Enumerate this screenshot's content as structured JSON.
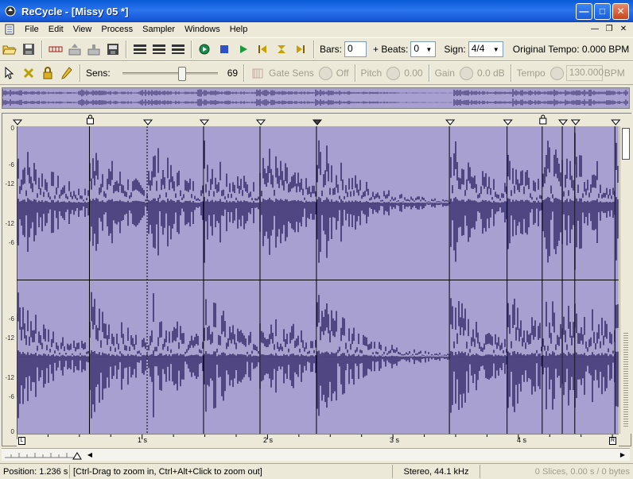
{
  "window": {
    "title": "ReCycle - [Missy 05 *]"
  },
  "menu": [
    "File",
    "Edit",
    "View",
    "Process",
    "Sampler",
    "Windows",
    "Help"
  ],
  "toolbar1": {
    "bars_label": "Bars:",
    "bars_value": "0",
    "beats_label": "+ Beats:",
    "beats_value": "0",
    "sign_label": "Sign:",
    "sign_value": "4/4",
    "original_tempo": "Original Tempo:  0.000 BPM"
  },
  "toolbar2": {
    "sens_label": "Sens:",
    "sens_value": "69",
    "gate_label": "Gate Sens",
    "gate_value": "Off",
    "pitch_label": "Pitch",
    "pitch_value": "0.00",
    "gain_label": "Gain",
    "gain_value": "0.0 dB",
    "tempo_label": "Tempo",
    "tempo_value": "130.000",
    "tempo_unit": "BPM"
  },
  "waveform": {
    "db_ticks": [
      "0",
      "-6",
      "-12",
      "-12",
      "-6",
      "-6",
      "-12",
      "-12",
      "-6",
      "0"
    ],
    "time_labels": [
      "1 s",
      "2 s",
      "3 s",
      "4 s"
    ],
    "marker_L": "L",
    "marker_R": "R",
    "slice_points_sec": [
      0.0,
      0.58,
      1.04,
      1.49,
      1.94,
      2.39,
      3.45,
      3.91,
      4.19,
      4.35,
      4.45,
      4.77
    ],
    "locked_slices_sec": [
      0.58,
      4.19
    ],
    "total_seconds": 4.8
  },
  "status": {
    "position": "Position: 1.236 s",
    "hint": "[Ctrl-Drag to zoom in, Ctrl+Alt+Click to zoom out]",
    "format": "Stereo, 44.1 kHz",
    "slices": "0 Slices, 0.00 s / 0 bytes"
  },
  "colors": {
    "wave_bg": "#a8a0d0",
    "wave_dark": "#2a2160",
    "wave_light": "#ddd8f8",
    "titlebar": "#0a5bd6"
  }
}
